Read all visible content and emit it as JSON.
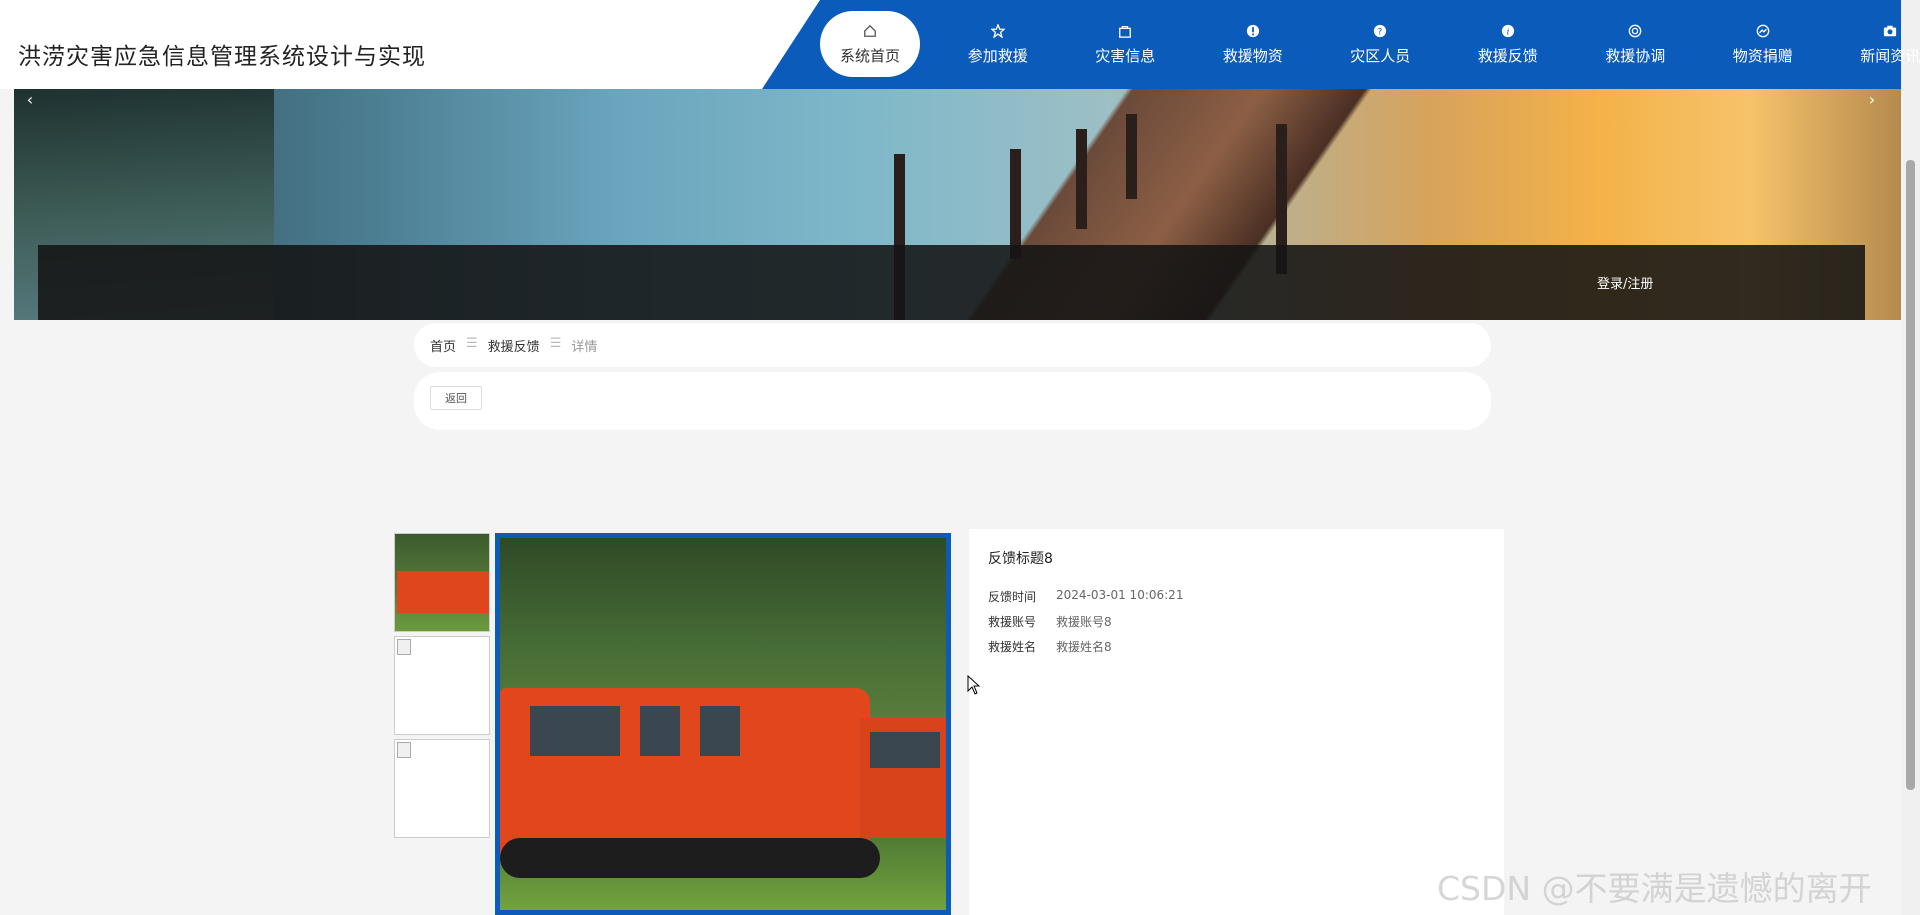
{
  "site": {
    "title": "洪涝灾害应急信息管理系统设计与实现"
  },
  "nav": [
    {
      "label": "系统首页",
      "icon": "home-icon",
      "active": true
    },
    {
      "label": "参加救援",
      "icon": "star-icon"
    },
    {
      "label": "灾害信息",
      "icon": "bag-icon"
    },
    {
      "label": "救援物资",
      "icon": "exclamation-circle-icon"
    },
    {
      "label": "灾区人员",
      "icon": "question-circle-icon"
    },
    {
      "label": "救援反馈",
      "icon": "info-circle-icon"
    },
    {
      "label": "救援协调",
      "icon": "target-icon"
    },
    {
      "label": "物资捐赠",
      "icon": "gauge-icon"
    },
    {
      "label": "新闻资讯",
      "icon": "camera-icon"
    }
  ],
  "banner": {
    "login_label": "登录/注册",
    "prev": "‹",
    "next": "›"
  },
  "breadcrumb": {
    "home": "首页",
    "section": "救援反馈",
    "current": "详情",
    "separator": "☰"
  },
  "back_label": "返回",
  "detail": {
    "title": "反馈标题8",
    "fields": [
      {
        "key": "反馈时间",
        "value": "2024-03-01 10:06:21"
      },
      {
        "key": "救援账号",
        "value": "救援账号8"
      },
      {
        "key": "救援姓名",
        "value": "救援姓名8"
      }
    ]
  },
  "watermark": "CSDN @不要满是遗憾的离开",
  "colors": {
    "primary": "#0b5bbb",
    "background": "#f4f4f4"
  }
}
